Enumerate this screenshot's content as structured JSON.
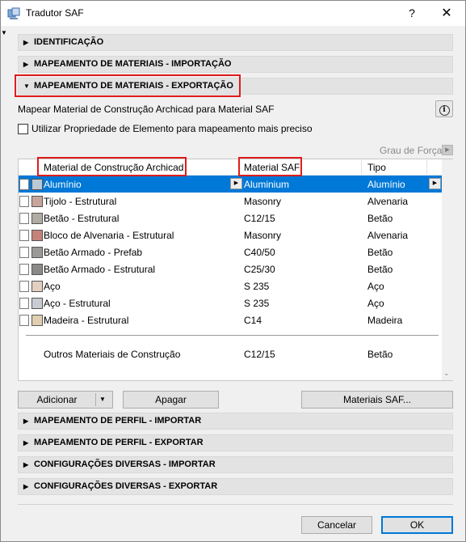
{
  "window": {
    "title": "Tradutor SAF",
    "help": "?",
    "close": "✕"
  },
  "sections_top": [
    {
      "label": "IDENTIFICAÇÃO",
      "arrow": "▶"
    },
    {
      "label": "MAPEAMENTO DE MATERIAIS - IMPORTAÇÃO",
      "arrow": "▶"
    },
    {
      "label": "MAPEAMENTO DE MATERIAIS - EXPORTAÇÃO",
      "arrow": "▼"
    }
  ],
  "description": "Mapear Material de Construção Archicad para Material SAF",
  "info_glyph": "i",
  "checkbox": {
    "label": "Utilizar Propriedade de Elemento para mapeamento mais preciso",
    "checked": false
  },
  "grau": {
    "label": "Grau de Força",
    "arrow": "▶"
  },
  "table": {
    "headers": [
      "Material de Construção Archicad",
      "Material SAF",
      "Tipo"
    ],
    "rows": [
      {
        "name": "Alumínio",
        "saf": "Aluminium",
        "type": "Alumínio",
        "color": "#b9c9d6",
        "selected": true
      },
      {
        "name": "Tijolo - Estrutural",
        "saf": "Masonry",
        "type": "Alvenaria",
        "color": "#c8a49c",
        "selected": false
      },
      {
        "name": "Betão - Estrutural",
        "saf": "C12/15",
        "type": "Betão",
        "color": "#b0aca4",
        "selected": false
      },
      {
        "name": "Bloco de Alvenaria - Estrutural",
        "saf": "Masonry",
        "type": "Alvenaria",
        "color": "#c4827a",
        "selected": false
      },
      {
        "name": "Betão Armado - Prefab",
        "saf": "C40/50",
        "type": "Betão",
        "color": "#9c9a98",
        "selected": false
      },
      {
        "name": "Betão Armado - Estrutural",
        "saf": "C25/30",
        "type": "Betão",
        "color": "#8c8a88",
        "selected": false
      },
      {
        "name": "Aço",
        "saf": "S 235",
        "type": "Aço",
        "color": "#e2cfc0",
        "selected": false
      },
      {
        "name": "Aço - Estrutural",
        "saf": "S 235",
        "type": "Aço",
        "color": "#c8ccd2",
        "selected": false
      },
      {
        "name": "Madeira - Estrutural",
        "saf": "C14",
        "type": "Madeira",
        "color": "#e0cfb0",
        "selected": false
      }
    ],
    "other": {
      "name": "Outros Materiais de Construção",
      "saf": "C12/15",
      "type": "Betão"
    },
    "row_arrow": "▶",
    "scroll_down": "⌄"
  },
  "buttons": {
    "add": "Adicionar",
    "add_arrow": "▼",
    "delete": "Apagar",
    "saf_materials": "Materiais SAF...",
    "cancel": "Cancelar",
    "ok": "OK"
  },
  "sections_bottom": [
    {
      "label": "MAPEAMENTO DE PERFIL - IMPORTAR",
      "arrow": "▶"
    },
    {
      "label": "MAPEAMENTO DE PERFIL - EXPORTAR",
      "arrow": "▶"
    },
    {
      "label": "CONFIGURAÇÕES DIVERSAS - IMPORTAR",
      "arrow": "▶"
    },
    {
      "label": "CONFIGURAÇÕES DIVERSAS - EXPORTAR",
      "arrow": "▶"
    }
  ],
  "accent_color": "#0078d7",
  "highlight_color": "#e01c1c"
}
